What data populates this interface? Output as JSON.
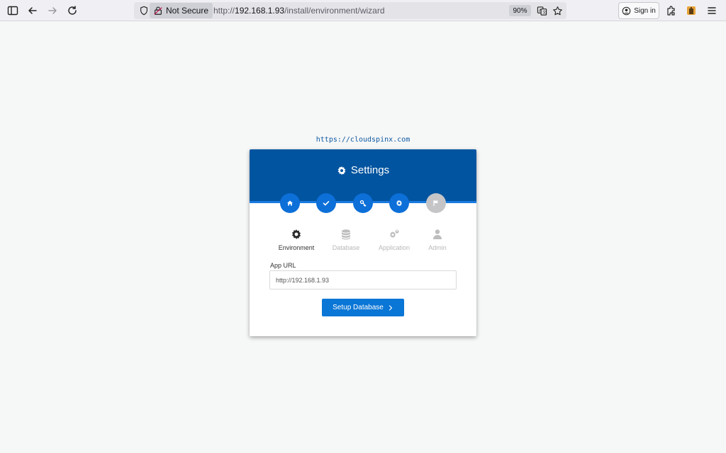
{
  "browser": {
    "security_label": "Not Secure",
    "url_prefix": "http://",
    "url_host": "192.168.1.93",
    "url_path": "/install/environment/wizard",
    "zoom": "90%",
    "signin_label": "Sign in"
  },
  "page": {
    "site_link": "https://cloudspinx.com",
    "title": "Settings",
    "steps": [
      {
        "icon": "home-icon",
        "state": "done"
      },
      {
        "icon": "check-icon",
        "state": "done"
      },
      {
        "icon": "key-icon",
        "state": "done"
      },
      {
        "icon": "gear-icon",
        "state": "done"
      },
      {
        "icon": "flag-icon",
        "state": "pending"
      }
    ],
    "tabs": [
      {
        "label": "Environment",
        "icon": "gear-icon",
        "active": true
      },
      {
        "label": "Database",
        "icon": "database-icon",
        "active": false
      },
      {
        "label": "Application",
        "icon": "gears-icon",
        "active": false
      },
      {
        "label": "Admin",
        "icon": "user-icon",
        "active": false
      }
    ],
    "app_url_label": "App URL",
    "app_url_value": "http://192.168.1.93",
    "submit_label": "Setup Database"
  },
  "colors": {
    "header_bg": "#0054a0",
    "step_active": "#0d6fd8",
    "step_inactive": "#c5c5c8",
    "button_bg": "#0a76d6",
    "link": "#0e5aa1"
  }
}
